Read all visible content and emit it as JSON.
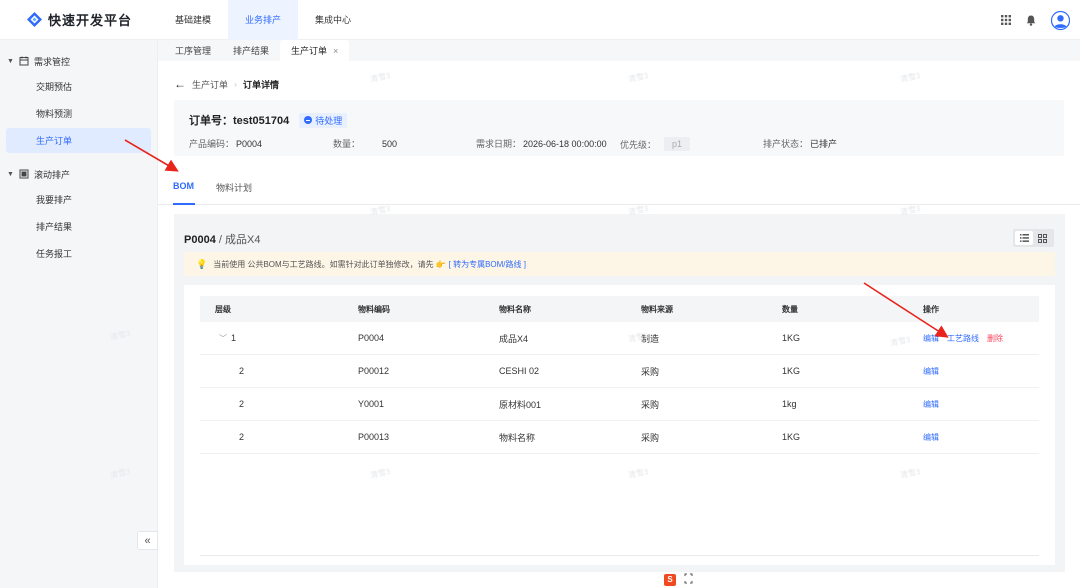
{
  "brand": {
    "name": "快速开发平台",
    "accent": "#2f6bff"
  },
  "topnav": {
    "items": [
      {
        "label": "基础建模",
        "active": false
      },
      {
        "label": "业务排产",
        "active": true
      },
      {
        "label": "集成中心",
        "active": false
      }
    ],
    "icons": [
      "apps-grid-icon",
      "bell-icon",
      "user-avatar-icon"
    ]
  },
  "sidebar": {
    "groups": [
      {
        "label": "需求管控",
        "icon": "calendar-icon",
        "items": [
          "交期预估",
          "物料预测",
          "生产订单"
        ]
      },
      {
        "label": "滚动排产",
        "icon": "board-icon",
        "items": [
          "我要排产",
          "排产结果",
          "任务报工"
        ]
      }
    ],
    "active_item": "生产订单",
    "collapse_symbol": "«"
  },
  "page_tabs": [
    {
      "label": "工序管理",
      "active": false
    },
    {
      "label": "排产结果",
      "active": false
    },
    {
      "label": "生产订单",
      "active": true,
      "close": "×"
    }
  ],
  "breadcrumb": {
    "back": "←",
    "parent": "生产订单",
    "current": "订单详情"
  },
  "order": {
    "title": "订单号：test051704",
    "status": "待处理",
    "product_label": "产品编码：",
    "product_value": "P0004",
    "qty_label": "数量：",
    "qty_value": "500",
    "date_label": "需求日期：",
    "date_value": "2026-06-18 00:00:00",
    "priority_label": "优先级：",
    "priority_value": "p1",
    "sched_label": "排产状态：",
    "sched_value": "已排产"
  },
  "content_tabs": [
    {
      "label": "BOM",
      "active": true
    },
    {
      "label": "物料计划",
      "active": false
    }
  ],
  "bom": {
    "code": "P0004",
    "name": " / 成品X4",
    "notice_text": "当前使用 公共BOM与工艺路线。如需针对此订单独修改，请先",
    "notice_link": "[ 转为专属BOM/路线 ]",
    "columns": [
      "层级",
      "物料编码",
      "物料名称",
      "物料来源",
      "数量",
      "操作"
    ],
    "rows": [
      {
        "level": "1",
        "tree": true,
        "code": "P0004",
        "name": "成品X4",
        "source": "制造",
        "qty": "1KG",
        "ops": [
          "编辑",
          "工艺路线",
          "删除"
        ]
      },
      {
        "level": "2",
        "tree": false,
        "code": "P00012",
        "name": "CESHI 02",
        "source": "采购",
        "qty": "1KG",
        "ops": [
          "编辑"
        ]
      },
      {
        "level": "2",
        "tree": false,
        "code": "Y0001",
        "name": "原材料001",
        "source": "采购",
        "qty": "1kg",
        "ops": [
          "编辑"
        ]
      },
      {
        "level": "2",
        "tree": false,
        "code": "P00013",
        "name": "物料名称",
        "source": "采购",
        "qty": "1KG",
        "ops": [
          "编辑"
        ]
      }
    ]
  },
  "watermark_text": "清雪3"
}
